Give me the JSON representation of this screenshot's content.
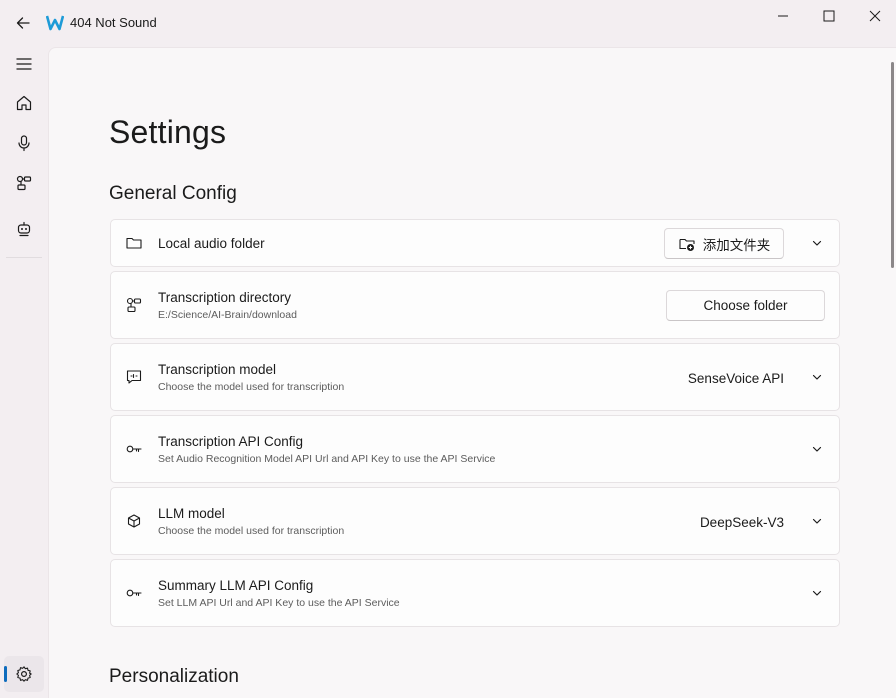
{
  "window": {
    "title": "404 Not Sound"
  },
  "page": {
    "title": "Settings"
  },
  "sections": {
    "general": "General Config",
    "personalization": "Personalization"
  },
  "cards": {
    "local_audio": {
      "title": "Local audio folder",
      "button": "添加文件夹"
    },
    "transcription_dir": {
      "title": "Transcription directory",
      "desc": "E:/Science/AI-Brain/download",
      "button": "Choose folder"
    },
    "transcription_model": {
      "title": "Transcription model",
      "desc": "Choose the model used for transcription",
      "value": "SenseVoice API"
    },
    "transcription_api": {
      "title": "Transcription API Config",
      "desc": "Set Audio Recognition Model API Url and API Key to use the API Service"
    },
    "llm_model": {
      "title": "LLM model",
      "desc": "Choose the model used for transcription",
      "value": "DeepSeek-V3"
    },
    "summary_llm_api": {
      "title": "Summary LLM API Config",
      "desc": "Set LLM API Url and API Key to use the API Service"
    }
  },
  "colors": {
    "accent": "#0f6cbd",
    "logo": "#1e9bd7"
  }
}
